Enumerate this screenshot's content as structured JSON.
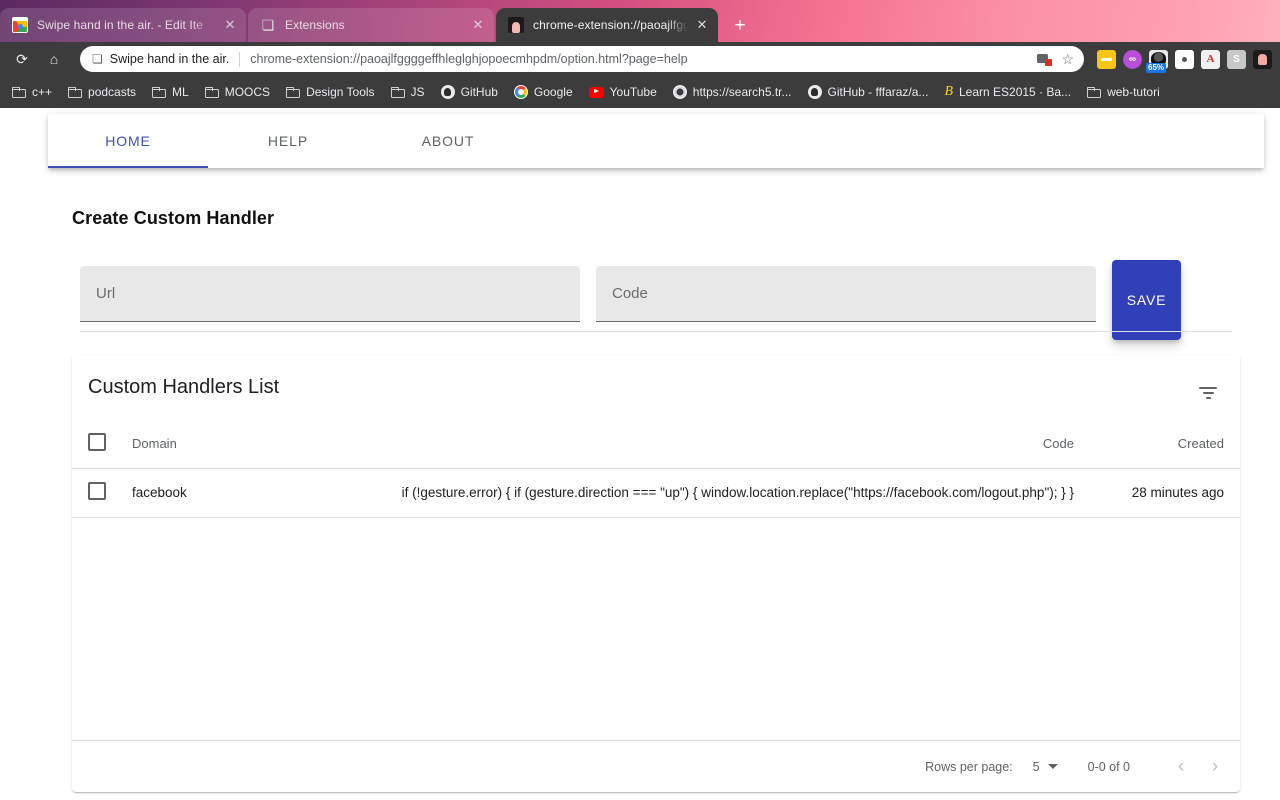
{
  "browser": {
    "tabs": [
      {
        "title": "Swipe hand in the air. - Edit Ite",
        "favicon": "chrome-webstore-icon",
        "active": false,
        "close": "✕"
      },
      {
        "title": "Extensions",
        "favicon": "puzzle-piece-icon",
        "active": false,
        "close": "✕"
      },
      {
        "title": "chrome-extension://paoajlfggg",
        "favicon": "hand-extension-icon",
        "active": true,
        "close": "✕"
      }
    ],
    "new_tab_label": "+",
    "toolbar": {
      "reload_icon": "⟳",
      "home_icon": "⌂",
      "omnibox": {
        "ext_icon": "puzzle-piece-icon",
        "ext_name": "Swipe hand in the air.",
        "url": "chrome-extension://paoajlfggggeffhleglghjopoecmhpdm/option.html?page=help",
        "camera_blocked_icon": "camera-blocked-icon",
        "bookmark_icon": "☆"
      },
      "extensions": [
        {
          "name": "dots-extension-icon",
          "badge": ""
        },
        {
          "name": "purple-circle-extension-icon",
          "badge": ""
        },
        {
          "name": "screen-recorder-extension-icon",
          "badge": "65%"
        },
        {
          "name": "white-square-extension-icon",
          "badge": ""
        },
        {
          "name": "red-book-extension-icon",
          "badge": ""
        },
        {
          "name": "s-extension-icon",
          "badge": ""
        },
        {
          "name": "hand-gesture-extension-icon",
          "badge": ""
        }
      ]
    },
    "bookmarks": [
      {
        "label": "c++",
        "icon": "folder-icon"
      },
      {
        "label": "podcasts",
        "icon": "folder-icon"
      },
      {
        "label": "ML",
        "icon": "folder-icon"
      },
      {
        "label": "MOOCS",
        "icon": "folder-icon"
      },
      {
        "label": "Design Tools",
        "icon": "folder-icon"
      },
      {
        "label": "JS",
        "icon": "folder-icon"
      },
      {
        "label": "GitHub",
        "icon": "github-icon"
      },
      {
        "label": "Google",
        "icon": "google-icon"
      },
      {
        "label": "YouTube",
        "icon": "youtube-icon"
      },
      {
        "label": "https://search5.tr...",
        "icon": "globe-icon"
      },
      {
        "label": "GitHub - fffaraz/a...",
        "icon": "github-icon"
      },
      {
        "label": "Learn ES2015 · Ba...",
        "icon": "babel-icon"
      },
      {
        "label": "web-tutori",
        "icon": "folder-icon"
      }
    ]
  },
  "app": {
    "nav_tabs": [
      {
        "label": "HOME",
        "active": true
      },
      {
        "label": "HELP",
        "active": false
      },
      {
        "label": "ABOUT",
        "active": false
      }
    ],
    "form": {
      "title": "Create Custom Handler",
      "url_placeholder": "Url",
      "url_value": "",
      "code_placeholder": "Code",
      "code_value": "",
      "save_label": "SAVE",
      "save_color": "#3040b8"
    },
    "table": {
      "title": "Custom Handlers List",
      "filter_icon": "filter-list-icon",
      "columns": [
        "Domain",
        "Code",
        "Created"
      ],
      "rows": [
        {
          "domain": "facebook",
          "code": "if (!gesture.error) { if (gesture.direction === \"up\") { window.location.replace(\"https://facebook.com/logout.php\"); } }",
          "created": "28 minutes ago",
          "selected": false
        }
      ],
      "footer": {
        "rows_per_page_label": "Rows per page:",
        "rows_per_page_value": "5",
        "range_label": "0-0 of 0",
        "prev_icon": "‹",
        "next_icon": "›"
      }
    }
  }
}
